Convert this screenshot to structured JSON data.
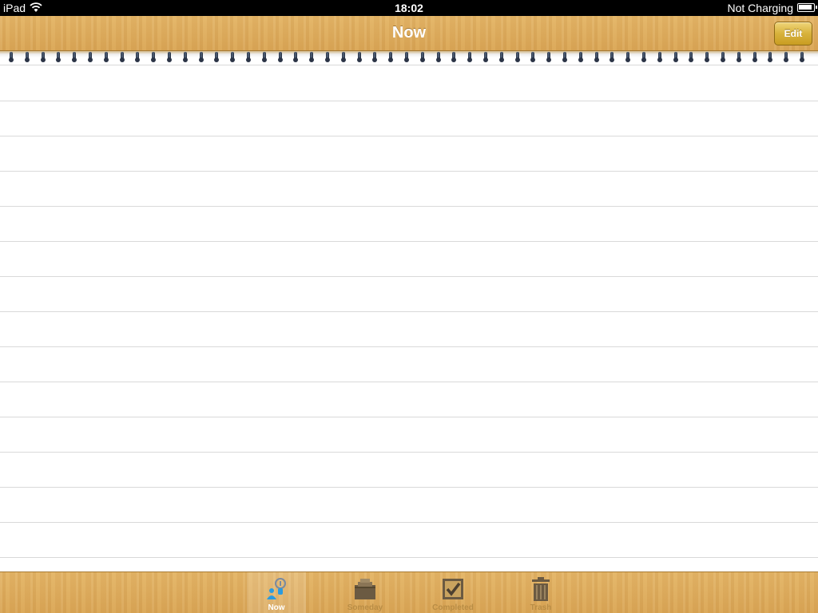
{
  "status_bar": {
    "device": "iPad",
    "time": "18:02",
    "charging_status": "Not Charging"
  },
  "nav_bar": {
    "title": "Now",
    "edit_label": "Edit"
  },
  "tab_bar": {
    "tabs": [
      {
        "label": "Now",
        "icon": "person-pin-icon",
        "selected": true
      },
      {
        "label": "Someday",
        "icon": "inbox-tray-icon",
        "selected": false
      },
      {
        "label": "Completed",
        "icon": "checkbox-icon",
        "selected": false
      },
      {
        "label": "Trash",
        "icon": "trash-can-icon",
        "selected": false
      }
    ]
  },
  "colors": {
    "wood": "#dba95a",
    "edit_button": "#d8b23c",
    "selected_tab_icon": "#2a9be0",
    "ring": "#2a3547"
  }
}
